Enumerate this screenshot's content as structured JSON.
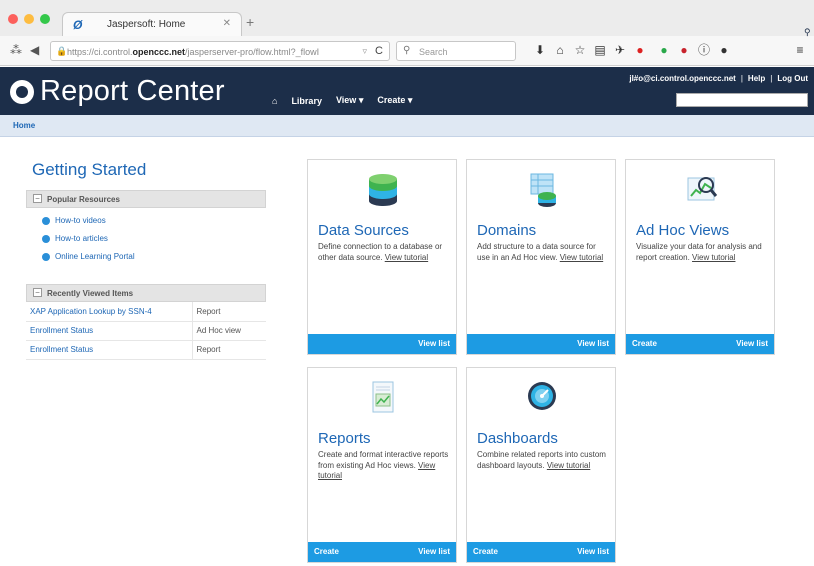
{
  "browser": {
    "tab_title": "Jaspersoft: Home",
    "url_prefix": "https://ci.control.",
    "url_domain": "openccc.net",
    "url_suffix": "/jasperserver-pro/flow.html?_flowI",
    "search_placeholder": "Search",
    "colors": {
      "close": "#fc605c",
      "minimize": "#fdbc40",
      "maximize": "#34c84a"
    }
  },
  "header": {
    "app_title": "Report Center",
    "nav": {
      "library": "Library",
      "view": "View",
      "create": "Create"
    },
    "user": "jl#o@ci.control.openccc.net",
    "help": "Help",
    "logout": "Log Out"
  },
  "breadcrumb": "Home",
  "getting_started": {
    "title": "Getting Started",
    "popular_title": "Popular Resources",
    "links": [
      "How-to videos",
      "How-to articles",
      "Online Learning Portal"
    ],
    "recent_title": "Recently Viewed Items",
    "recent": [
      {
        "name": "XAP Application Lookup by SSN-4",
        "type": "Report"
      },
      {
        "name": "Enrollment Status",
        "type": "Ad Hoc view"
      },
      {
        "name": "Enrollment Status",
        "type": "Report"
      }
    ]
  },
  "cards": {
    "data_sources": {
      "title": "Data Sources",
      "desc": "Define connection to a database or other data source.",
      "tutorial": "View tutorial",
      "right": "View list"
    },
    "domains": {
      "title": "Domains",
      "desc": "Add structure to a data source for use in an Ad Hoc view.",
      "tutorial": "View tutorial",
      "right": "View list"
    },
    "adhoc": {
      "title": "Ad Hoc Views",
      "desc": "Visualize your data for analysis and report creation.",
      "tutorial": "View tutorial",
      "left": "Create",
      "right": "View list"
    },
    "reports": {
      "title": "Reports",
      "desc": "Create and format interactive reports from existing Ad Hoc views.",
      "tutorial": "View tutorial",
      "left": "Create",
      "right": "View list"
    },
    "dashboards": {
      "title": "Dashboards",
      "desc": "Combine related reports into custom dashboard layouts.",
      "tutorial": "View tutorial",
      "left": "Create",
      "right": "View list"
    }
  },
  "colors": {
    "header_bg": "#1c2e49",
    "accent": "#1d9be3",
    "link": "#1e67b5"
  }
}
